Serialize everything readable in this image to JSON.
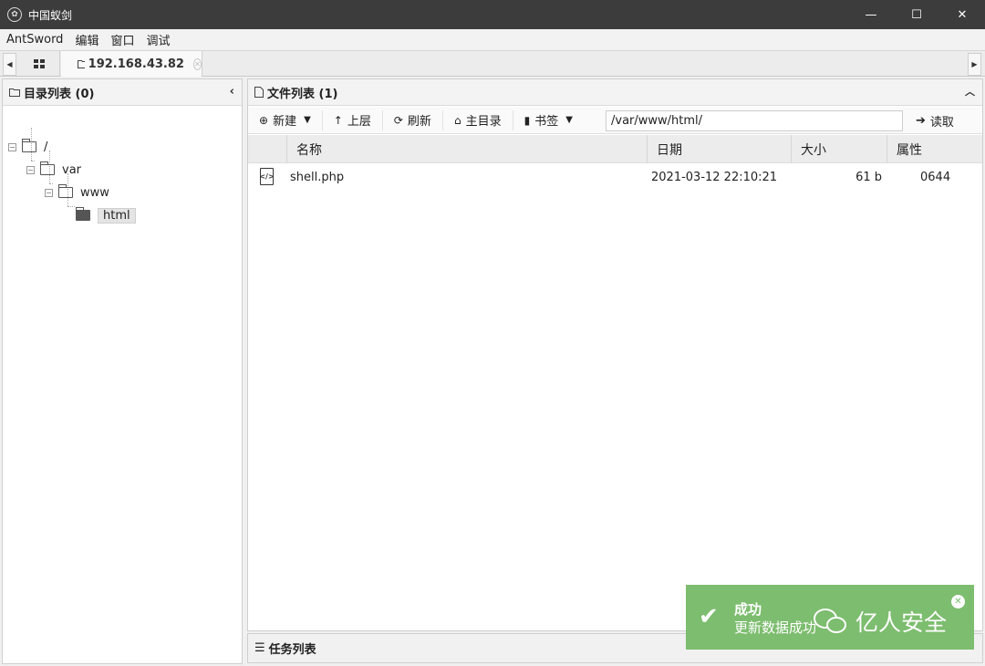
{
  "window": {
    "title": "中国蚁剑",
    "minimize_glyph": "—",
    "maximize_glyph": "☐",
    "close_glyph": "✕"
  },
  "menubar": {
    "items": [
      "AntSword",
      "编辑",
      "窗口",
      "调试"
    ]
  },
  "tabs": {
    "home_icon": "grid-icon",
    "active_tab_label": "192.168.43.82",
    "left_arrow": "◀",
    "right_arrow": "▶"
  },
  "dir_panel": {
    "title": "目录列表 (0)",
    "tree": [
      {
        "label": "/",
        "level": 0
      },
      {
        "label": "var",
        "level": 1
      },
      {
        "label": "www",
        "level": 2
      },
      {
        "label": "html",
        "level": 3,
        "selected": true
      }
    ]
  },
  "file_panel": {
    "title": "文件列表 (1)",
    "toolbar": {
      "new_label": "新建",
      "up_label": "上层",
      "refresh_label": "刷新",
      "home_label": "主目录",
      "bookmark_label": "书签",
      "path_value": "/var/www/html/",
      "read_label": "读取"
    },
    "columns": [
      "名称",
      "日期",
      "大小",
      "属性"
    ],
    "rows": [
      {
        "name": "shell.php",
        "date": "2021-03-12 22:10:21",
        "size": "61 b",
        "attr": "0644"
      }
    ]
  },
  "task_panel": {
    "title": "任务列表"
  },
  "toast": {
    "title": "成功",
    "message": "更新数据成功",
    "watermark": "亿人安全"
  },
  "colors": {
    "titlebar": "#3c3c3c",
    "toast": "#7dbd6f"
  }
}
